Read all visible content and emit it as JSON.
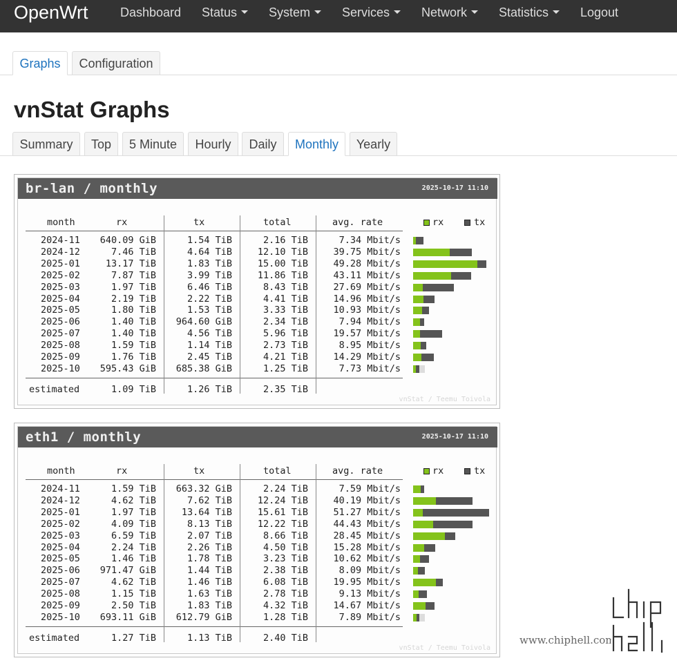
{
  "brand": "OpenWrt",
  "nav": [
    {
      "label": "Dashboard",
      "caret": false
    },
    {
      "label": "Status",
      "caret": true
    },
    {
      "label": "System",
      "caret": true
    },
    {
      "label": "Services",
      "caret": true
    },
    {
      "label": "Network",
      "caret": true
    },
    {
      "label": "Statistics",
      "caret": true
    },
    {
      "label": "Logout",
      "caret": false
    }
  ],
  "top_tabs": [
    {
      "label": "Graphs",
      "active": true
    },
    {
      "label": "Configuration",
      "active": false
    }
  ],
  "page_title": "vnStat Graphs",
  "sub_tabs": [
    {
      "label": "Summary",
      "active": false
    },
    {
      "label": "Top",
      "active": false
    },
    {
      "label": "5 Minute",
      "active": false
    },
    {
      "label": "Hourly",
      "active": false
    },
    {
      "label": "Daily",
      "active": false
    },
    {
      "label": "Monthly",
      "active": true
    },
    {
      "label": "Yearly",
      "active": false
    }
  ],
  "colors": {
    "rx": "#84c31b",
    "tx": "#555555",
    "header": "#5a5a5a",
    "link": "#1e73be"
  },
  "columns": {
    "month": "month",
    "rx": "rx",
    "tx": "tx",
    "total": "total",
    "rate": "avg. rate",
    "legend_rx": "rx",
    "legend_tx": "tx"
  },
  "estimated_label": "estimated",
  "credit": "vnStat / Teemu Toivola",
  "panels": [
    {
      "title": "br-lan / monthly",
      "date": "2025-10-17 11:10",
      "rows": [
        {
          "month": "2024-11",
          "rx": "640.09 GiB",
          "tx": "1.54 TiB",
          "total": "2.16 TiB",
          "rate": "7.34 Mbit/s",
          "rx_tib": 0.625,
          "tx_tib": 1.54
        },
        {
          "month": "2024-12",
          "rx": "7.46 TiB",
          "tx": "4.64 TiB",
          "total": "12.10 TiB",
          "rate": "39.75 Mbit/s",
          "rx_tib": 7.46,
          "tx_tib": 4.64
        },
        {
          "month": "2025-01",
          "rx": "13.17 TiB",
          "tx": "1.83 TiB",
          "total": "15.00 TiB",
          "rate": "49.28 Mbit/s",
          "rx_tib": 13.17,
          "tx_tib": 1.83
        },
        {
          "month": "2025-02",
          "rx": "7.87 TiB",
          "tx": "3.99 TiB",
          "total": "11.86 TiB",
          "rate": "43.11 Mbit/s",
          "rx_tib": 7.87,
          "tx_tib": 3.99
        },
        {
          "month": "2025-03",
          "rx": "1.97 TiB",
          "tx": "6.46 TiB",
          "total": "8.43 TiB",
          "rate": "27.69 Mbit/s",
          "rx_tib": 1.97,
          "tx_tib": 6.46
        },
        {
          "month": "2025-04",
          "rx": "2.19 TiB",
          "tx": "2.22 TiB",
          "total": "4.41 TiB",
          "rate": "14.96 Mbit/s",
          "rx_tib": 2.19,
          "tx_tib": 2.22
        },
        {
          "month": "2025-05",
          "rx": "1.80 TiB",
          "tx": "1.53 TiB",
          "total": "3.33 TiB",
          "rate": "10.93 Mbit/s",
          "rx_tib": 1.8,
          "tx_tib": 1.53
        },
        {
          "month": "2025-06",
          "rx": "1.40 TiB",
          "tx": "964.60 GiB",
          "total": "2.34 TiB",
          "rate": "7.94 Mbit/s",
          "rx_tib": 1.4,
          "tx_tib": 0.94
        },
        {
          "month": "2025-07",
          "rx": "1.40 TiB",
          "tx": "4.56 TiB",
          "total": "5.96 TiB",
          "rate": "19.57 Mbit/s",
          "rx_tib": 1.4,
          "tx_tib": 4.56
        },
        {
          "month": "2025-08",
          "rx": "1.59 TiB",
          "tx": "1.14 TiB",
          "total": "2.73 TiB",
          "rate": "8.95 Mbit/s",
          "rx_tib": 1.59,
          "tx_tib": 1.14
        },
        {
          "month": "2025-09",
          "rx": "1.76 TiB",
          "tx": "2.45 TiB",
          "total": "4.21 TiB",
          "rate": "14.29 Mbit/s",
          "rx_tib": 1.76,
          "tx_tib": 2.45
        },
        {
          "month": "2025-10",
          "rx": "595.43 GiB",
          "tx": "685.38 GiB",
          "total": "1.25 TiB",
          "rate": "7.73 Mbit/s",
          "rx_tib": 0.58,
          "tx_tib": 0.67,
          "est_total_tib": 2.35
        }
      ],
      "estimated": {
        "rx": "1.09 TiB",
        "tx": "1.26 TiB",
        "total": "2.35 TiB"
      }
    },
    {
      "title": "eth1 / monthly",
      "date": "2025-10-17 11:10",
      "rows": [
        {
          "month": "2024-11",
          "rx": "1.59 TiB",
          "tx": "663.32 GiB",
          "total": "2.24 TiB",
          "rate": "7.59 Mbit/s",
          "rx_tib": 1.59,
          "tx_tib": 0.65
        },
        {
          "month": "2024-12",
          "rx": "4.62 TiB",
          "tx": "7.62 TiB",
          "total": "12.24 TiB",
          "rate": "40.19 Mbit/s",
          "rx_tib": 4.62,
          "tx_tib": 7.62
        },
        {
          "month": "2025-01",
          "rx": "1.97 TiB",
          "tx": "13.64 TiB",
          "total": "15.61 TiB",
          "rate": "51.27 Mbit/s",
          "rx_tib": 1.97,
          "tx_tib": 13.64
        },
        {
          "month": "2025-02",
          "rx": "4.09 TiB",
          "tx": "8.13 TiB",
          "total": "12.22 TiB",
          "rate": "44.43 Mbit/s",
          "rx_tib": 4.09,
          "tx_tib": 8.13
        },
        {
          "month": "2025-03",
          "rx": "6.59 TiB",
          "tx": "2.07 TiB",
          "total": "8.66 TiB",
          "rate": "28.45 Mbit/s",
          "rx_tib": 6.59,
          "tx_tib": 2.07
        },
        {
          "month": "2025-04",
          "rx": "2.24 TiB",
          "tx": "2.26 TiB",
          "total": "4.50 TiB",
          "rate": "15.28 Mbit/s",
          "rx_tib": 2.24,
          "tx_tib": 2.26
        },
        {
          "month": "2025-05",
          "rx": "1.46 TiB",
          "tx": "1.78 TiB",
          "total": "3.23 TiB",
          "rate": "10.62 Mbit/s",
          "rx_tib": 1.46,
          "tx_tib": 1.78
        },
        {
          "month": "2025-06",
          "rx": "971.47 GiB",
          "tx": "1.44 TiB",
          "total": "2.38 TiB",
          "rate": "8.09 Mbit/s",
          "rx_tib": 0.95,
          "tx_tib": 1.44
        },
        {
          "month": "2025-07",
          "rx": "4.62 TiB",
          "tx": "1.46 TiB",
          "total": "6.08 TiB",
          "rate": "19.95 Mbit/s",
          "rx_tib": 4.62,
          "tx_tib": 1.46
        },
        {
          "month": "2025-08",
          "rx": "1.15 TiB",
          "tx": "1.63 TiB",
          "total": "2.78 TiB",
          "rate": "9.13 Mbit/s",
          "rx_tib": 1.15,
          "tx_tib": 1.63
        },
        {
          "month": "2025-09",
          "rx": "2.50 TiB",
          "tx": "1.83 TiB",
          "total": "4.32 TiB",
          "rate": "14.67 Mbit/s",
          "rx_tib": 2.5,
          "tx_tib": 1.83
        },
        {
          "month": "2025-10",
          "rx": "693.11 GiB",
          "tx": "612.79 GiB",
          "total": "1.28 TiB",
          "rate": "7.89 Mbit/s",
          "rx_tib": 0.68,
          "tx_tib": 0.6,
          "est_total_tib": 2.4
        }
      ],
      "estimated": {
        "rx": "1.27 TiB",
        "tx": "1.13 TiB",
        "total": "2.40 TiB"
      }
    }
  ],
  "watermark": {
    "site": "www.chiphell.com",
    "logo": "chip hell"
  }
}
